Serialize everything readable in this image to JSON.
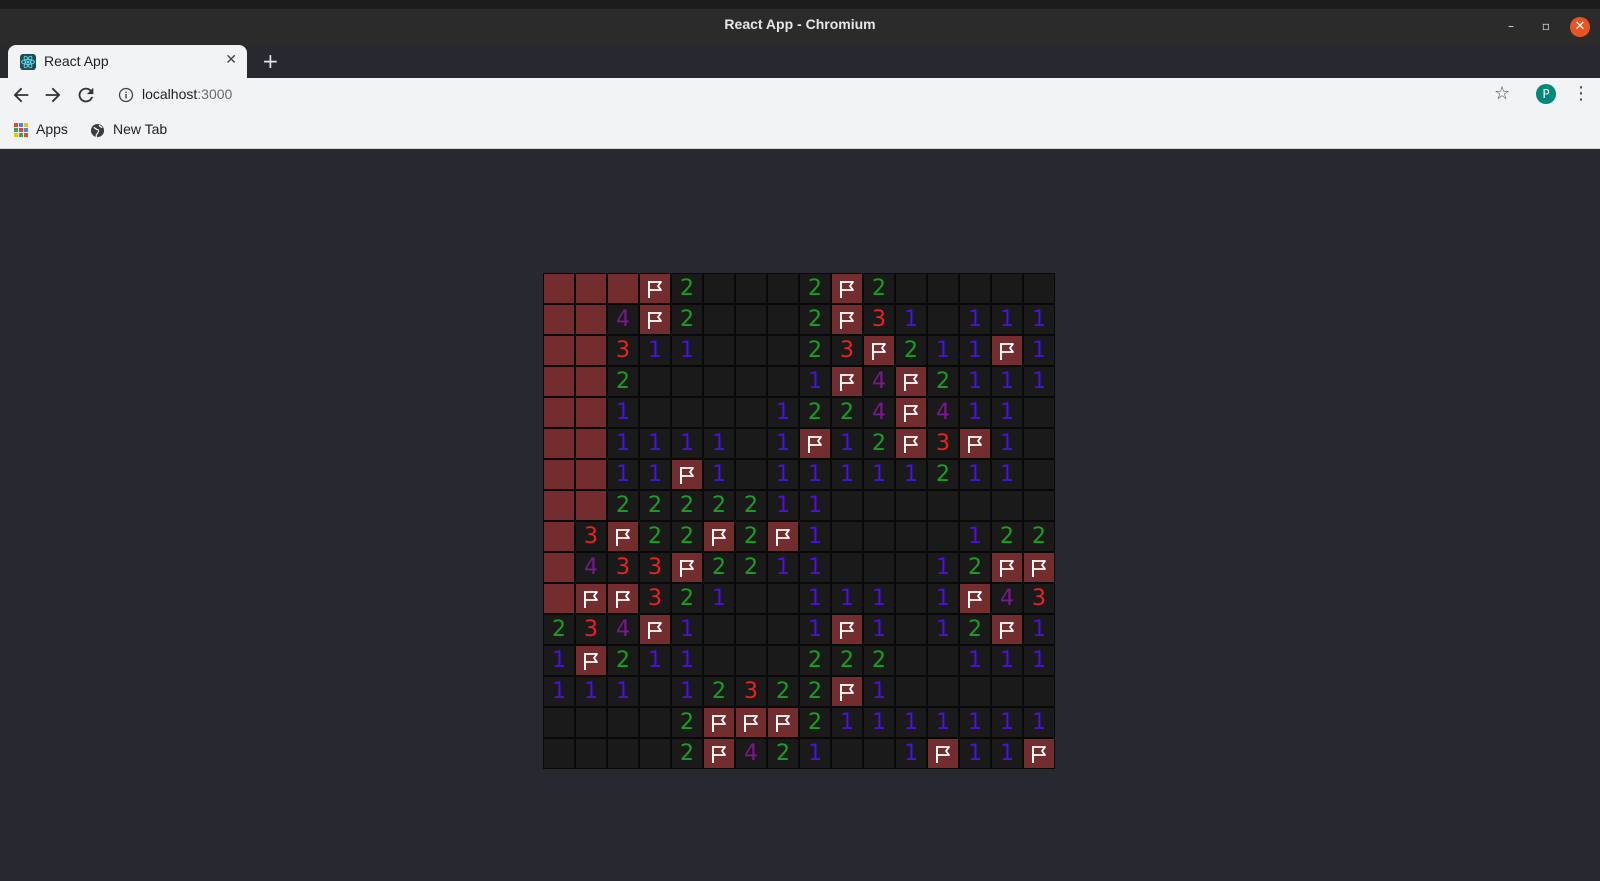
{
  "window": {
    "title": "React App - Chromium"
  },
  "tab": {
    "label": "React App"
  },
  "address": {
    "host": "localhost",
    "port": ":3000"
  },
  "profile": {
    "initial": "P"
  },
  "bookmarks": [
    {
      "label": "Apps",
      "icon": "apps-grid-icon"
    },
    {
      "label": "New Tab",
      "icon": "globe-icon"
    }
  ],
  "colors": {
    "page_bg": "#282830",
    "cell_open": "#1a1a1a",
    "cell_covered": "#742d2e",
    "n1": "#4a12d8",
    "n2": "#18a11f",
    "n3": "#f02020",
    "n4": "#7a1890",
    "close_button": "#e95420"
  },
  "board": {
    "legend": "C = covered, F = flagged, 0 = empty revealed, 1-4 = adjacent mine count",
    "rows": [
      [
        "C",
        "C",
        "C",
        "F",
        "2",
        "0",
        "0",
        "0",
        "2",
        "F",
        "2",
        "0",
        "0",
        "0",
        "0",
        "0"
      ],
      [
        "C",
        "C",
        "4",
        "F",
        "2",
        "0",
        "0",
        "0",
        "2",
        "F",
        "3",
        "1",
        "0",
        "1",
        "1",
        "1"
      ],
      [
        "C",
        "C",
        "3",
        "1",
        "1",
        "0",
        "0",
        "0",
        "2",
        "3",
        "F",
        "2",
        "1",
        "1",
        "F",
        "1"
      ],
      [
        "C",
        "C",
        "2",
        "0",
        "0",
        "0",
        "0",
        "0",
        "1",
        "F",
        "4",
        "F",
        "2",
        "1",
        "1",
        "1"
      ],
      [
        "C",
        "C",
        "1",
        "0",
        "0",
        "0",
        "0",
        "1",
        "2",
        "2",
        "4",
        "F",
        "4",
        "1",
        "1",
        "0"
      ],
      [
        "C",
        "C",
        "1",
        "1",
        "1",
        "1",
        "0",
        "1",
        "F",
        "1",
        "2",
        "F",
        "3",
        "F",
        "1",
        "0"
      ],
      [
        "C",
        "C",
        "1",
        "1",
        "F",
        "1",
        "0",
        "1",
        "1",
        "1",
        "1",
        "1",
        "2",
        "1",
        "1",
        "0"
      ],
      [
        "C",
        "C",
        "2",
        "2",
        "2",
        "2",
        "2",
        "1",
        "1",
        "0",
        "0",
        "0",
        "0",
        "0",
        "0",
        "0"
      ],
      [
        "C",
        "3",
        "F",
        "2",
        "2",
        "F",
        "2",
        "F",
        "1",
        "0",
        "0",
        "0",
        "0",
        "1",
        "2",
        "2"
      ],
      [
        "C",
        "4",
        "3",
        "3",
        "F",
        "2",
        "2",
        "1",
        "1",
        "0",
        "0",
        "0",
        "1",
        "2",
        "F",
        "F"
      ],
      [
        "C",
        "F",
        "F",
        "3",
        "2",
        "1",
        "0",
        "0",
        "1",
        "1",
        "1",
        "0",
        "1",
        "F",
        "4",
        "3"
      ],
      [
        "2",
        "3",
        "4",
        "F",
        "1",
        "0",
        "0",
        "0",
        "1",
        "F",
        "1",
        "0",
        "1",
        "2",
        "F",
        "1"
      ],
      [
        "1",
        "F",
        "2",
        "1",
        "1",
        "0",
        "0",
        "0",
        "2",
        "2",
        "2",
        "0",
        "0",
        "1",
        "1",
        "1"
      ],
      [
        "1",
        "1",
        "1",
        "0",
        "1",
        "2",
        "3",
        "2",
        "2",
        "F",
        "1",
        "0",
        "0",
        "0",
        "0",
        "0"
      ],
      [
        "0",
        "0",
        "0",
        "0",
        "2",
        "F",
        "F",
        "F",
        "2",
        "1",
        "1",
        "1",
        "1",
        "1",
        "1",
        "1"
      ],
      [
        "0",
        "0",
        "0",
        "0",
        "2",
        "F",
        "4",
        "2",
        "1",
        "0",
        "0",
        "1",
        "F",
        "1",
        "1",
        "F"
      ]
    ]
  }
}
